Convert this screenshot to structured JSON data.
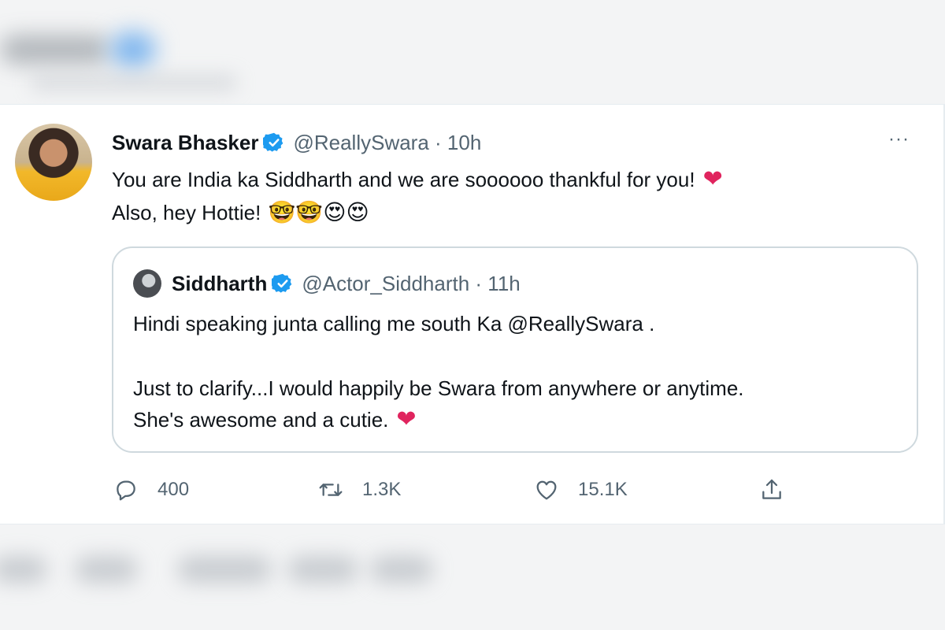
{
  "colors": {
    "verified": "#1d9bf0",
    "heart": "#e0245e",
    "secondary_text": "#536471",
    "border": "#cfd9de"
  },
  "tweet": {
    "author_name": "Swara Bhasker",
    "author_handle": "@ReallySwara · 10h",
    "more_icon": "···",
    "line1": "You are India ka Siddharth and we are soooooo thankful for you!",
    "line1_emoji": "❤",
    "line2": "Also, hey Hottie!",
    "line2_emojis": "🤓🤓😍😍",
    "quoted": {
      "author_name": "Siddharth",
      "author_handle": "@Actor_Siddharth · 11h",
      "line1": "Hindi speaking junta calling me south Ka @ReallySwara .",
      "line2": "Just to clarify...I would happily be Swara from anywhere or anytime.",
      "line3": "She's awesome and a cutie.",
      "line3_emoji": "❤"
    },
    "actions": {
      "reply_count": "400",
      "retweet_count": "1.3K",
      "like_count": "15.1K"
    }
  }
}
